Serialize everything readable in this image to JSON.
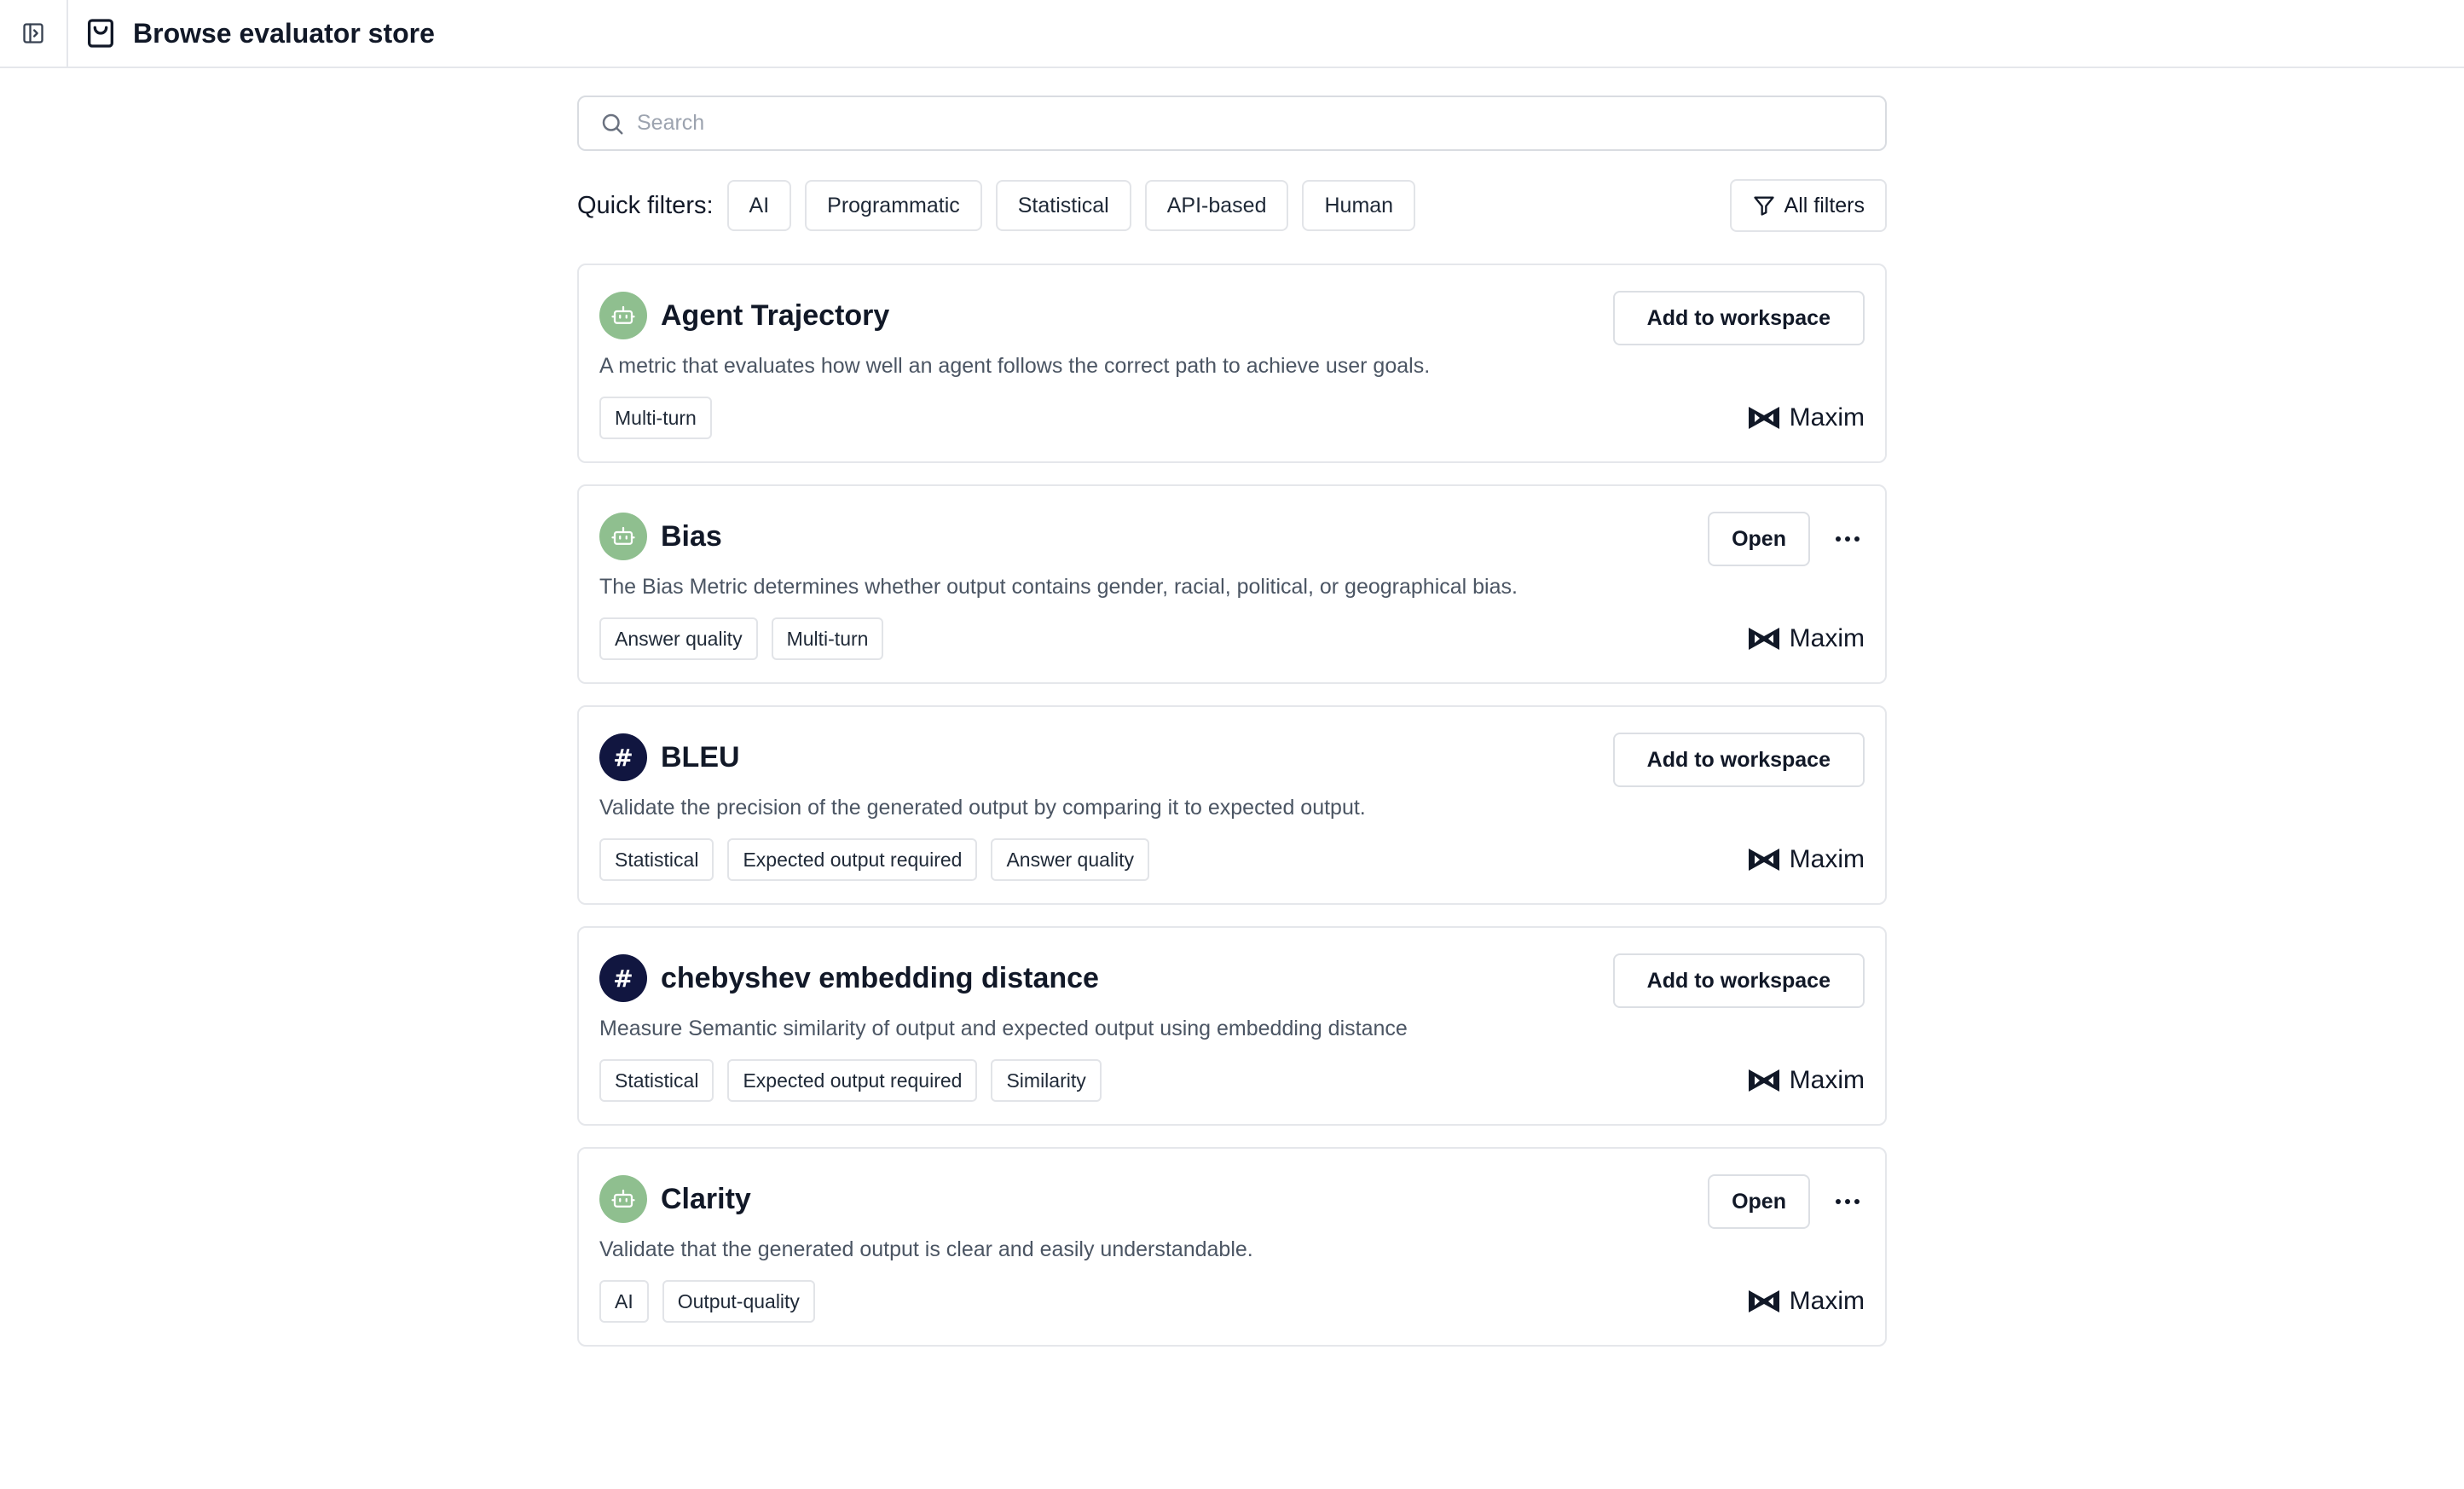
{
  "header": {
    "title": "Browse evaluator store"
  },
  "search": {
    "placeholder": "Search"
  },
  "quick_filters": {
    "label": "Quick filters:",
    "chips": [
      "AI",
      "Programmatic",
      "Statistical",
      "API-based",
      "Human"
    ],
    "all_filters_label": "All filters"
  },
  "cards": [
    {
      "title": "Agent Trajectory",
      "icon": "robot-icon",
      "description": "A metric that evaluates how well an agent follows the correct path to achieve user goals.",
      "tags": [
        "Multi-turn"
      ],
      "action_label": "Add to workspace",
      "brand": "Maxim"
    },
    {
      "title": "Bias",
      "icon": "robot-icon",
      "description": "The Bias Metric determines whether output contains gender, racial, political, or geographical bias.",
      "tags": [
        "Answer quality",
        "Multi-turn"
      ],
      "action_label": "Open",
      "brand": "Maxim"
    },
    {
      "title": "BLEU",
      "icon": "hash-icon",
      "description": "Validate the precision of the generated output by comparing it to expected output.",
      "tags": [
        "Statistical",
        "Expected output required",
        "Answer quality"
      ],
      "action_label": "Add to workspace",
      "brand": "Maxim"
    },
    {
      "title": "chebyshev embedding distance",
      "icon": "hash-icon",
      "description": "Measure Semantic similarity of output and expected output using embedding distance",
      "tags": [
        "Statistical",
        "Expected output required",
        "Similarity"
      ],
      "action_label": "Add to workspace",
      "brand": "Maxim"
    },
    {
      "title": "Clarity",
      "icon": "robot-icon",
      "description": "Validate that the generated output is clear and easily understandable.",
      "tags": [
        "AI",
        "Output-quality"
      ],
      "action_label": "Open",
      "brand": "Maxim"
    }
  ],
  "colors": {
    "ai_avatar": "#8fbf8f",
    "statistical_avatar": "#111640",
    "border": "#e5e7eb"
  }
}
